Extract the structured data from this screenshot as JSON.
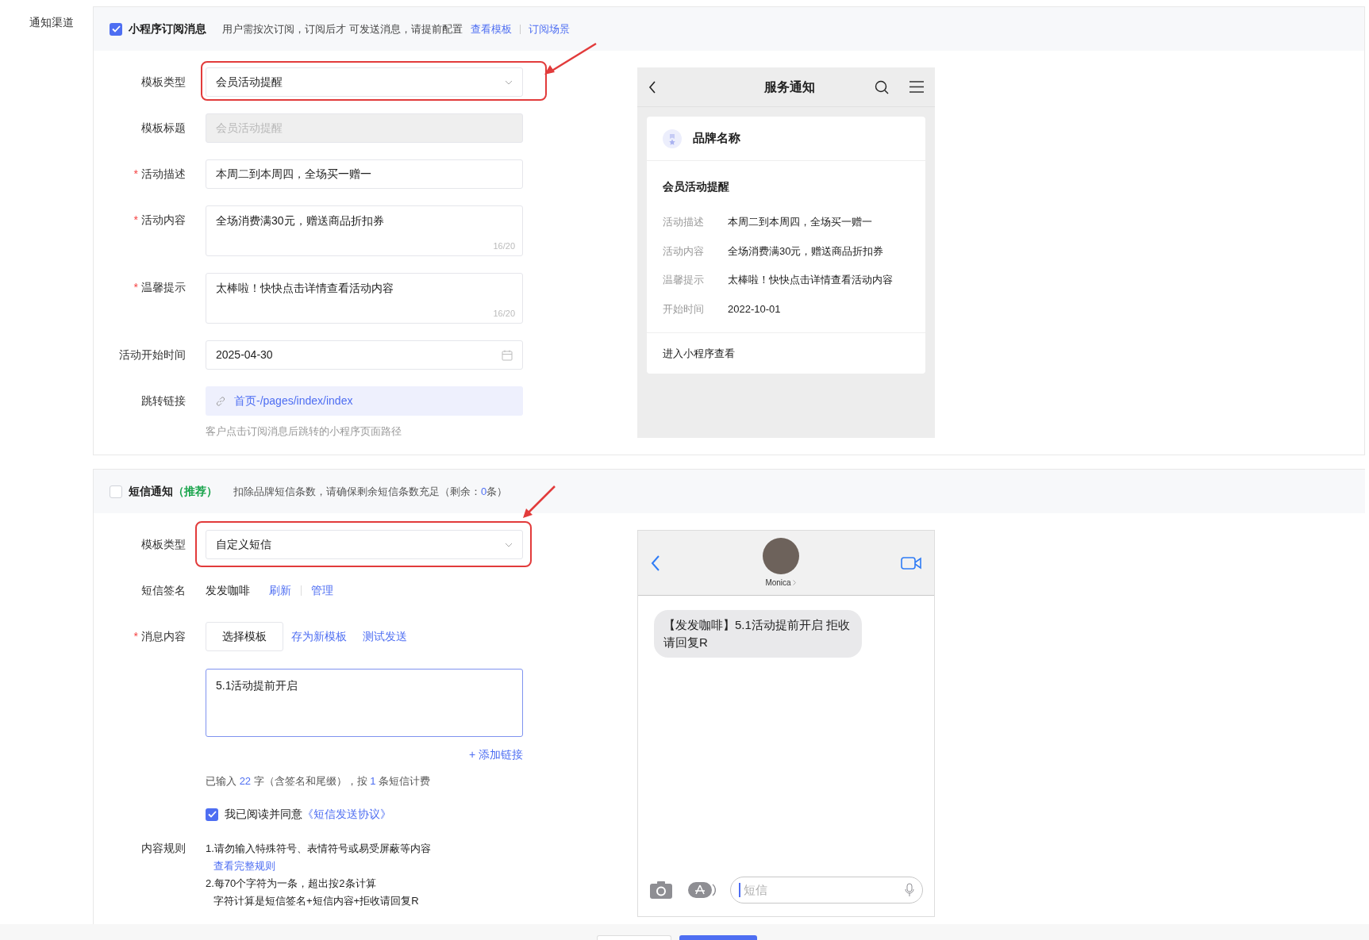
{
  "channel_label": "通知渠道",
  "required_mark": "*",
  "subscription": {
    "checked": true,
    "title": "小程序订阅消息",
    "description": "用户需按次订阅，订阅后才 可发送消息，请提前配置",
    "links": [
      "查看模板",
      "订阅场景"
    ],
    "fields": [
      {
        "kind": "select",
        "label": "模板类型",
        "required": false,
        "value": "会员活动提醒",
        "highlighted": true
      },
      {
        "kind": "input",
        "label": "模板标题",
        "required": false,
        "value": "会员活动提醒",
        "disabled": true
      },
      {
        "kind": "input",
        "label": "活动描述",
        "required": true,
        "value": "本周二到本周四，全场买一赠一",
        "disabled": false
      },
      {
        "kind": "textarea",
        "label": "活动内容",
        "required": true,
        "value": "全场消费满30元，赠送商品折扣券",
        "counter": "16/20"
      },
      {
        "kind": "textarea",
        "label": "温馨提示",
        "required": true,
        "value": "太棒啦！快快点击详情查看活动内容",
        "counter": "16/20"
      },
      {
        "kind": "date",
        "label": "活动开始时间",
        "required": false,
        "value": "2025-04-30"
      },
      {
        "kind": "link",
        "label": "跳转链接",
        "required": false,
        "value": "首页-/pages/index/index",
        "hint": "客户点击订阅消息后跳转的小程序页面路径"
      }
    ],
    "preview": {
      "title": "服务通知",
      "brand": "品牌名称",
      "card_title": "会员活动提醒",
      "rows": [
        {
          "label": "活动描述",
          "value": "本周二到本周四，全场买一赠一"
        },
        {
          "label": "活动内容",
          "value": "全场消费满30元，赠送商品折扣券"
        },
        {
          "label": "温馨提示",
          "value": "太棒啦！快快点击详情查看活动内容"
        },
        {
          "label": "开始时间",
          "value": "2022-10-01"
        }
      ],
      "action": "进入小程序查看"
    }
  },
  "sms": {
    "checked": false,
    "title": "短信通知",
    "tag": "（推荐）",
    "description": [
      {
        "text": "扣除品牌短信条数，请确保剩余短信条数充足（剩余：",
        "highlight": false
      },
      {
        "text": "0",
        "highlight": true
      },
      {
        "text": "条）",
        "highlight": false
      }
    ],
    "template": {
      "label": "模板类型",
      "value": "自定义短信",
      "highlighted": true
    },
    "signature": {
      "label": "短信签名",
      "value": "发发咖啡",
      "links": [
        "刷新",
        "管理"
      ]
    },
    "content": {
      "label": "消息内容",
      "required": true,
      "button": "选择模板",
      "links": [
        "存为新模板",
        "测试发送"
      ],
      "value": "5.1活动提前开启",
      "add_link": "+ 添加链接",
      "count": [
        {
          "text": "已输入 ",
          "highlight": false
        },
        {
          "text": "22",
          "highlight": true
        },
        {
          "text": " 字（含签名和尾缀），按 ",
          "highlight": false
        },
        {
          "text": "1",
          "highlight": true
        },
        {
          "text": " 条短信计费",
          "highlight": false
        }
      ],
      "agreement": {
        "checked": true,
        "text": "我已阅读并同意",
        "link": "《短信发送协议》"
      }
    },
    "rules": {
      "label": "内容规则",
      "lines": [
        {
          "kind": "text",
          "text": "1.请勿输入特殊符号、表情符号或易受屏蔽等内容"
        },
        {
          "kind": "link",
          "text": "查看完整规则"
        },
        {
          "kind": "text",
          "text": "2.每70个字符为一条，超出按2条计算"
        },
        {
          "kind": "note",
          "text": "字符计算是短信签名+短信内容+拒收请回复R"
        }
      ]
    },
    "preview": {
      "contact": "Monica",
      "message": "【发发咖啡】5.1活动提前开启 拒收请回复R",
      "placeholder": "短信"
    }
  }
}
